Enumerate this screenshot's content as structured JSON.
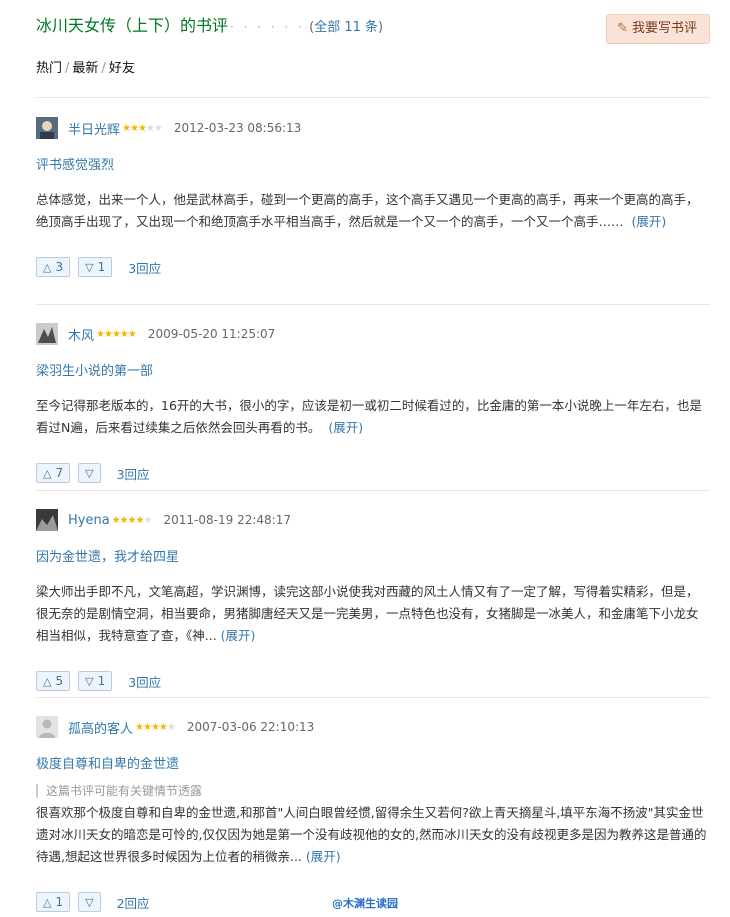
{
  "header": {
    "title": "冰川天女传（上下）的书评",
    "dots": "· · · · · ·",
    "count_open": "(",
    "count_text": "全部 11 条",
    "count_close": ")",
    "write_button": "我要写书评"
  },
  "tabs": [
    "热门",
    "最新",
    "好友"
  ],
  "reviews": [
    {
      "author": "半日光辉",
      "stars": "★★★☆☆",
      "rating": 3,
      "date": "2012-03-23 08:56:13",
      "title": "评书感觉强烈",
      "spoiler": "",
      "body": "总体感觉，出来一个人，他是武林高手，碰到一个更高的高手，这个高手又遇见一个更高的高手，再来一个更高的高手，绝顶高手出现了，又出现一个和绝顶高手水平相当高手，然后就是一个又一个的高手，一个又一个高手……",
      "expand": "(展开)",
      "up": "3",
      "down": "1",
      "replies": "3回应"
    },
    {
      "author": "木风",
      "stars": "★★★★★",
      "rating": 5,
      "date": "2009-05-20 11:25:07",
      "title": "梁羽生小说的第一部",
      "spoiler": "",
      "body": "至今记得那老版本的，16开的大书，很小的字，应该是初一或初二时候看过的，比金庸的第一本小说晚上一年左右，也是看过N遍，后来看过续集之后依然会回头再看的书。",
      "expand": "(展开)",
      "up": "7",
      "down": "",
      "replies": "3回应"
    },
    {
      "author": "Hyena",
      "stars": "★★★★☆",
      "rating": 4,
      "date": "2011-08-19 22:48:17",
      "title": "因为金世遗，我才给四星",
      "spoiler": "",
      "body": "梁大师出手即不凡，文笔高超，学识渊博，读完这部小说使我对西藏的风土人情又有了一定了解，写得着实精彩，但是，很无奈的是剧情空洞，相当要命，男猪脚唐经天又是一完美男，一点特色也没有，女猪脚是一冰美人，和金庸笔下小龙女相当相似，我特意查了查，《神...",
      "expand": "(展开)",
      "up": "5",
      "down": "1",
      "replies": "3回应"
    },
    {
      "author": "孤高的客人",
      "stars": "★★★★☆",
      "rating": 4,
      "date": "2007-03-06 22:10:13",
      "title": "极度自尊和自卑的金世遗",
      "spoiler": "这篇书评可能有关键情节透露",
      "body": "很喜欢那个极度自尊和自卑的金世遗,和那首\"人间白眼曾经惯,留得余生又若何?欲上青天摘星斗,填平东海不扬波\"其实金世遗对冰川天女的暗恋是可怜的,仅仅因为她是第一个没有歧视他的女的,然而冰川天女的没有歧视更多是因为教养这是普通的待遇,想起这世界很多时候因为上位者的稍微亲...",
      "expand": "(展开)",
      "up": "1",
      "down": "",
      "replies": "2回应"
    }
  ],
  "watermark": "@木渊生读园"
}
